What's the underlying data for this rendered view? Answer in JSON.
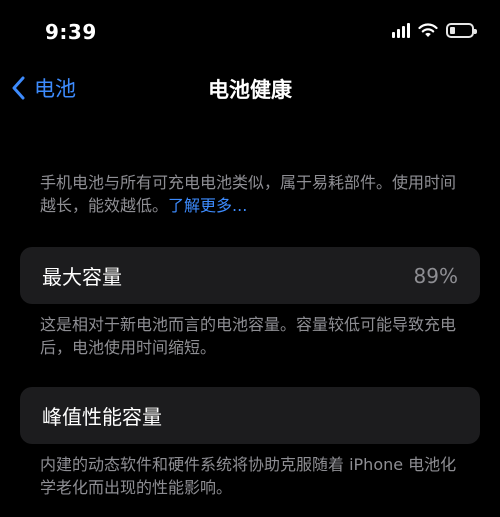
{
  "status_bar": {
    "time": "9:39",
    "icons": [
      "cellular-signal-icon",
      "wifi-icon",
      "battery-icon"
    ],
    "battery_level": 0.25
  },
  "nav": {
    "back_label": "电池",
    "title": "电池健康"
  },
  "intro": {
    "text": "手机电池与所有可充电电池类似，属于易耗部件。使用时间越长，能效越低。",
    "link": "了解更多..."
  },
  "max_capacity": {
    "label": "最大容量",
    "value": "89%",
    "footnote": "这是相对于新电池而言的电池容量。容量较低可能导致充电后，电池使用时间缩短。"
  },
  "peak_performance": {
    "label": "峰值性能容量",
    "footnote": "内建的动态软件和硬件系统将协助克服随着 iPhone 电池化学老化而出现的性能影响。"
  },
  "colors": {
    "background": "#000000",
    "card": "#1c1c1e",
    "accent": "#3d8bfd",
    "secondary_text": "#8e8e93"
  }
}
